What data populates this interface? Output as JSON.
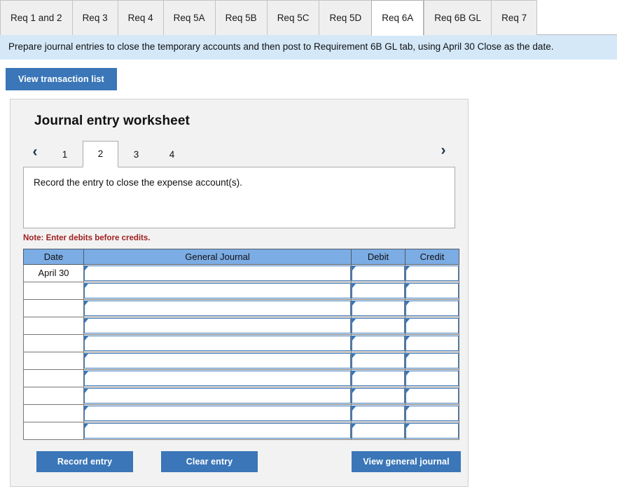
{
  "tabs": [
    {
      "label": "Req 1 and 2",
      "active": false
    },
    {
      "label": "Req 3",
      "active": false
    },
    {
      "label": "Req 4",
      "active": false
    },
    {
      "label": "Req 5A",
      "active": false
    },
    {
      "label": "Req 5B",
      "active": false
    },
    {
      "label": "Req 5C",
      "active": false
    },
    {
      "label": "Req 5D",
      "active": false
    },
    {
      "label": "Req 6A",
      "active": true
    },
    {
      "label": "Req 6B GL",
      "active": false
    },
    {
      "label": "Req 7",
      "active": false
    }
  ],
  "banner": {
    "text": "Prepare journal entries to close the temporary accounts and then post to Requirement 6B GL tab, using April 30 Close as the date."
  },
  "toolbar": {
    "view_transaction_list_label": "View transaction list"
  },
  "worksheet": {
    "title": "Journal entry worksheet",
    "pager": {
      "prev_icon": "‹",
      "next_icon": "›",
      "pages": [
        "1",
        "2",
        "3",
        "4"
      ],
      "active_page": "2"
    },
    "description": "Record the entry to close the expense account(s).",
    "note": "Note: Enter debits before credits.",
    "table": {
      "columns": [
        "Date",
        "General Journal",
        "Debit",
        "Credit"
      ],
      "rows": [
        {
          "date": "April 30",
          "general_journal": "",
          "debit": "",
          "credit": ""
        },
        {
          "date": "",
          "general_journal": "",
          "debit": "",
          "credit": ""
        },
        {
          "date": "",
          "general_journal": "",
          "debit": "",
          "credit": ""
        },
        {
          "date": "",
          "general_journal": "",
          "debit": "",
          "credit": ""
        },
        {
          "date": "",
          "general_journal": "",
          "debit": "",
          "credit": ""
        },
        {
          "date": "",
          "general_journal": "",
          "debit": "",
          "credit": ""
        },
        {
          "date": "",
          "general_journal": "",
          "debit": "",
          "credit": ""
        },
        {
          "date": "",
          "general_journal": "",
          "debit": "",
          "credit": ""
        },
        {
          "date": "",
          "general_journal": "",
          "debit": "",
          "credit": ""
        },
        {
          "date": "",
          "general_journal": "",
          "debit": "",
          "credit": ""
        }
      ]
    },
    "actions": {
      "record_label": "Record entry",
      "clear_label": "Clear entry",
      "view_general_journal_label": "View general journal"
    }
  },
  "colors": {
    "button_blue": "#3a76b8",
    "table_header_blue": "#7cace4",
    "banner_blue": "#d4e8f8",
    "panel_gray": "#f2f2f2",
    "note_red": "#a02020"
  }
}
